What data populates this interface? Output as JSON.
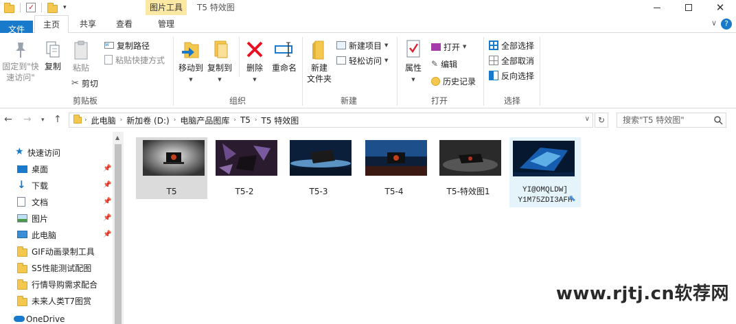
{
  "window": {
    "title": "T5 特效图",
    "context_tab": "图片工具"
  },
  "tabs": {
    "file": "文件",
    "home": "主页",
    "share": "共享",
    "view": "查看",
    "manage": "管理"
  },
  "ribbon": {
    "clipboard": {
      "group": "剪贴板",
      "pin_quick_access": [
        "固定到\"快",
        "速访问\""
      ],
      "copy": "复制",
      "paste": "粘贴",
      "copy_path": "复制路径",
      "paste_shortcut": "粘贴快捷方式",
      "cut": "剪切"
    },
    "organize": {
      "group": "组织",
      "move_to": "移动到",
      "copy_to": "复制到",
      "delete": "删除",
      "rename": "重命名"
    },
    "new": {
      "group": "新建",
      "new_folder": [
        "新建",
        "文件夹"
      ],
      "new_item": "新建项目",
      "easy_access": "轻松访问"
    },
    "open": {
      "group": "打开",
      "properties": "属性",
      "open": "打开",
      "edit": "编辑",
      "history": "历史记录"
    },
    "select": {
      "group": "选择",
      "select_all": "全部选择",
      "select_none": "全部取消",
      "invert": "反向选择"
    }
  },
  "address": {
    "crumbs": [
      "此电脑",
      "新加卷 (D:)",
      "电脑产品图库",
      "T5",
      "T5 特效图"
    ],
    "search_placeholder": "搜索\"T5 特效图\""
  },
  "nav": {
    "items": [
      {
        "label": "快速访问",
        "icon": "star-icon",
        "pinned": false
      },
      {
        "label": "桌面",
        "icon": "desktop-icon",
        "pinned": true
      },
      {
        "label": "下载",
        "icon": "download-icon",
        "pinned": true
      },
      {
        "label": "文档",
        "icon": "document-icon",
        "pinned": true
      },
      {
        "label": "图片",
        "icon": "picture-icon",
        "pinned": true
      },
      {
        "label": "此电脑",
        "icon": "computer-icon",
        "pinned": true
      },
      {
        "label": "GIF动画录制工具",
        "icon": "folder-icon",
        "pinned": false
      },
      {
        "label": "S5性能测试配图",
        "icon": "folder-icon",
        "pinned": false
      },
      {
        "label": "行情导购需求配合",
        "icon": "folder-icon",
        "pinned": false
      },
      {
        "label": "未来人类T7图赏",
        "icon": "folder-icon",
        "pinned": false
      },
      {
        "label": "OneDrive",
        "icon": "cloud-icon",
        "pinned": false
      }
    ]
  },
  "files": [
    {
      "name": "T5",
      "state": "selected"
    },
    {
      "name": "T5-2",
      "state": "normal"
    },
    {
      "name": "T5-3",
      "state": "normal"
    },
    {
      "name": "T5-4",
      "state": "normal"
    },
    {
      "name": "T5-特效图1",
      "state": "normal"
    },
    {
      "name_lines": [
        "YI@OMQLDW]",
        "Y1M75ZDI3AFH"
      ],
      "state": "renaming"
    }
  ],
  "watermark": "www.rjtj.cn软荐网",
  "colors": {
    "accent": "#1979ca",
    "context_tab": "#fbe9a3",
    "selection": "#dbdbdb",
    "delete_red": "#e81123"
  }
}
